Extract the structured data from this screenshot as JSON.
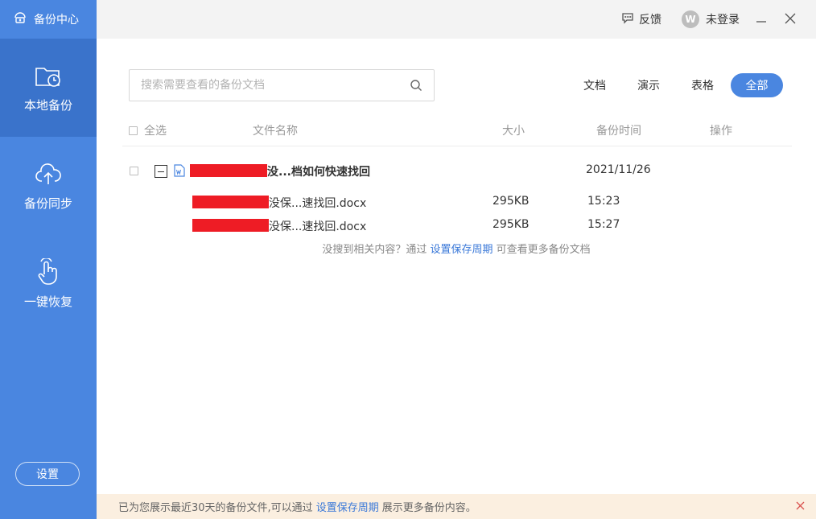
{
  "app": {
    "title": "备份中心"
  },
  "sidebar": {
    "items": [
      {
        "label": "本地备份",
        "icon": "folder-clock-icon",
        "active": true
      },
      {
        "label": "备份同步",
        "icon": "cloud-upload-icon",
        "active": false
      },
      {
        "label": "一键恢复",
        "icon": "hand-pointer-icon",
        "active": false
      }
    ],
    "settings_label": "设置"
  },
  "titlebar": {
    "feedback_label": "反馈",
    "login_label": "未登录",
    "avatar_letter": "W"
  },
  "search": {
    "placeholder": "搜索需要查看的备份文档"
  },
  "filters": {
    "doc": "文档",
    "ppt": "演示",
    "xls": "表格",
    "all": "全部",
    "selected": "全部"
  },
  "table": {
    "headers": {
      "select_all": "全选",
      "name": "文件名称",
      "size": "大小",
      "time": "备份时间",
      "action": "操作"
    },
    "group": {
      "name": "没...档如何快速找回",
      "date": "2021/11/26",
      "expanded": true
    },
    "files": [
      {
        "name": "没保...速找回.docx",
        "size": "295KB",
        "time": "15:23"
      },
      {
        "name": "没保...速找回.docx",
        "size": "295KB",
        "time": "15:27"
      }
    ]
  },
  "notice": {
    "prefix": "没搜到相关内容？通过",
    "link": "设置保存周期",
    "suffix": "可查看更多备份文档"
  },
  "bottombar": {
    "prefix": "已为您展示最近30天的备份文件,可以通过",
    "link": "设置保存周期",
    "suffix": "展示更多备份内容。"
  },
  "colors": {
    "sidebar": "#4a86e0",
    "sidebar_active": "#3a73cb",
    "accent": "#4a86e0",
    "link": "#3a78d8",
    "redaction": "#ee1c25",
    "bottombar": "#fbefe0"
  }
}
